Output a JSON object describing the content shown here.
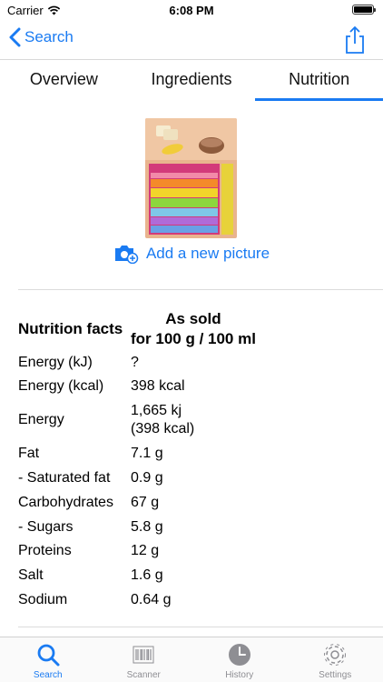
{
  "status_bar": {
    "carrier": "Carrier",
    "time": "6:08 PM"
  },
  "nav": {
    "back_label": "Search"
  },
  "tabs": [
    {
      "label": "Overview"
    },
    {
      "label": "Ingredients"
    },
    {
      "label": "Nutrition"
    }
  ],
  "image": {
    "add_picture_label": "Add a new picture"
  },
  "nutrition": {
    "header_label": "Nutrition facts",
    "column_line1": "As sold",
    "column_line2": "for 100 g / 100 ml",
    "rows": [
      {
        "name": "Energy (kJ)",
        "value": "?"
      },
      {
        "name": "Energy (kcal)",
        "value": "398 kcal"
      },
      {
        "name": "Energy",
        "value": "1,665 kj",
        "value2": "(398 kcal)"
      },
      {
        "name": "Fat",
        "value": "7.1 g"
      },
      {
        "name": "- Saturated fat",
        "value": "0.9 g"
      },
      {
        "name": "Carbohydrates",
        "value": "67 g"
      },
      {
        "name": "- Sugars",
        "value": "5.8 g"
      },
      {
        "name": "Proteins",
        "value": "12 g"
      },
      {
        "name": "Salt",
        "value": "1.6 g"
      },
      {
        "name": "Sodium",
        "value": "0.64 g"
      }
    ]
  },
  "tab_bar": [
    {
      "label": "Search",
      "icon": "search-icon",
      "active": true
    },
    {
      "label": "Scanner",
      "icon": "barcode-icon"
    },
    {
      "label": "History",
      "icon": "clock-icon"
    },
    {
      "label": "Settings",
      "icon": "gear-icon"
    }
  ],
  "colors": {
    "accent": "#1a7bf2"
  }
}
